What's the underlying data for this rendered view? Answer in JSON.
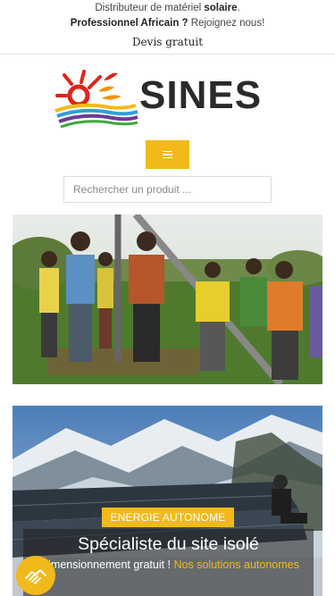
{
  "topbar": {
    "line1_prefix": "Distributeur de matériel ",
    "line1_bold": "solaire",
    "line1_suffix": ".",
    "line2_bold": "Professionnel Africain ?",
    "line2_suffix": " Rejoignez nous!",
    "quote_link": "Devis gratuit"
  },
  "brand": {
    "name": "SINES",
    "accent": "#f2b91a"
  },
  "menu": {
    "icon": "hamburger-icon"
  },
  "search": {
    "placeholder": "Rechercher un produit ..."
  },
  "slide": {
    "tag": "ENERGIE AUTONOME",
    "title": "Spécialiste du site isolé",
    "subtitle_white": "Dimensionnement gratuit ! ",
    "subtitle_highlight": "Nos solutions autonomes"
  },
  "badge": {
    "icon": "handshake-icon"
  }
}
